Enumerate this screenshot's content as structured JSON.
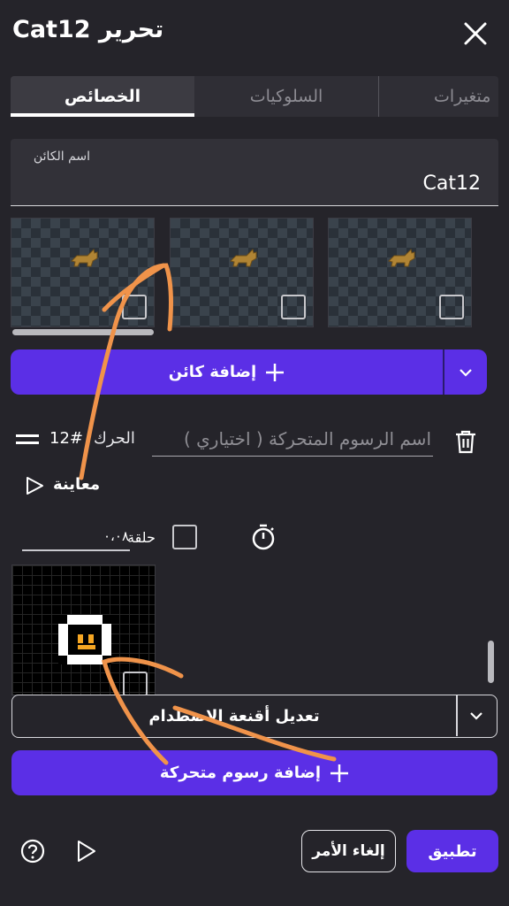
{
  "header": {
    "title": "تحرير Cat12",
    "close_icon": "close-icon"
  },
  "tabs": [
    {
      "label": "الخصائص",
      "active": true
    },
    {
      "label": "السلوكيات",
      "active": false
    },
    {
      "label": "متغيرات",
      "active": false
    }
  ],
  "object_name": {
    "label": "اسم الكائن",
    "value": "Cat12"
  },
  "add_sprite": {
    "label": "إضافة كائن"
  },
  "animation": {
    "number": "12#",
    "word": "الحرك",
    "name_placeholder": "اسم الرسوم المتحركة ( اختياري )",
    "preview_label": "معاينة",
    "fps_value": "٠،٠٨",
    "loop_label": "حلقة"
  },
  "collision_masks": {
    "label": "تعديل أقنعة الاصطدام"
  },
  "add_animation": {
    "label": "إضافة رسوم متحركة"
  },
  "footer": {
    "cancel_label": "إلغاء الأمر",
    "apply_label": "تطبيق"
  },
  "colors": {
    "accent": "#5b2fe6",
    "background": "#25242a",
    "annotation": "#f0934a"
  }
}
